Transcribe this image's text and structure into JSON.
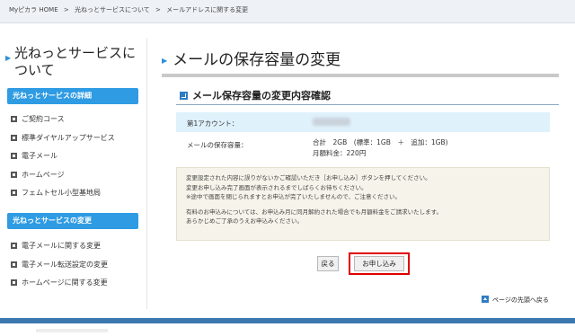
{
  "breadcrumb": [
    "Myピカラ HOME",
    ">",
    "光ねっとサービスについて",
    ">",
    "メールアドレスに関する変更"
  ],
  "sidebar": {
    "title": "光ねっとサービスについて",
    "section1": {
      "heading": "光ねっとサービスの詳細",
      "items": [
        "ご契約コース",
        "標準ダイヤルアップサービス",
        "電子メール",
        "ホームページ",
        "フェムトセル小型基地局"
      ]
    },
    "section2": {
      "heading": "光ねっとサービスの変更",
      "items": [
        "電子メールに関する変更",
        "電子メール転送設定の変更",
        "ホームページに関する変更"
      ]
    }
  },
  "main": {
    "title": "メールの保存容量の変更",
    "section_title": "メール保存容量の変更内容確認",
    "account_label": "第1アカウント：",
    "storage_label": "メールの保存容量：",
    "storage_value": "合計　2GB　(標準：1GB　＋　追加：1GB)",
    "monthly_fee": "月額料金：220円",
    "notice_lines": [
      "変更設定された内容に誤りがないかご確認いただき［お申し込み］ボタンを押してください。",
      "変更お申し込み完了画面が表示されるまでしばらくお待ちください。",
      "※途中で画面を閉じられますとお申込が完了いたしませんので、ご注意ください。"
    ],
    "notice_lines2": [
      "有料のお申込みについては、お申込み月に同月解約された場合でも月額料金をご請求いたします。",
      "あらかじめご了承のうえお申込みください。"
    ],
    "back_button": "戻る",
    "apply_button": "お申し込み",
    "page_top": "ページの先頭へ戻る"
  },
  "colors": {
    "accent": "#2e9be3",
    "highlight_border": "#e00000",
    "info_row": "#dff1fb",
    "notice_bg": "#f6f4ea"
  }
}
